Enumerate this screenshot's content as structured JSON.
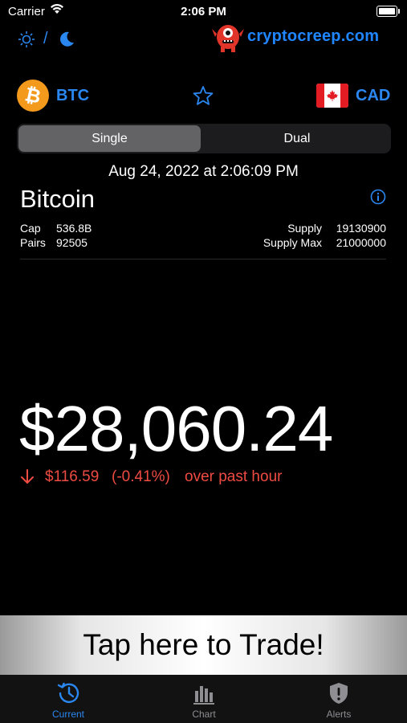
{
  "status_bar": {
    "carrier": "Carrier",
    "time": "2:06 PM"
  },
  "header": {
    "logo_text": "cryptocreep.com",
    "theme_separator": "/"
  },
  "coin": {
    "code": "BTC",
    "symbol": "₿",
    "name": "Bitcoin"
  },
  "fiat": {
    "code": "CAD"
  },
  "segmented": {
    "single_label": "Single",
    "dual_label": "Dual",
    "selected": "Single"
  },
  "timestamp": "Aug 24, 2022 at 2:06:09 PM",
  "stats": {
    "cap_label": "Cap",
    "cap_value": "536.8B",
    "pairs_label": "Pairs",
    "pairs_value": "92505",
    "supply_label": "Supply",
    "supply_value": "19130900",
    "supply_max_label": "Supply Max",
    "supply_max_value": "21000000"
  },
  "price": {
    "value": "$28,060.24",
    "change_amount": "$116.59",
    "change_percent": "(-0.41%)",
    "change_text": "over past hour"
  },
  "trade_banner": {
    "label": "Tap here to Trade!"
  },
  "tabs": [
    {
      "label": "Current",
      "icon": "clock-history-icon",
      "active": true
    },
    {
      "label": "Chart",
      "icon": "bar-chart-icon",
      "active": false
    },
    {
      "label": "Alerts",
      "icon": "shield-alert-icon",
      "active": false
    }
  ],
  "colors": {
    "accent": "#2b87f0",
    "negative": "#ee4b42",
    "btc_orange": "#f39a1c",
    "background": "#000000"
  }
}
